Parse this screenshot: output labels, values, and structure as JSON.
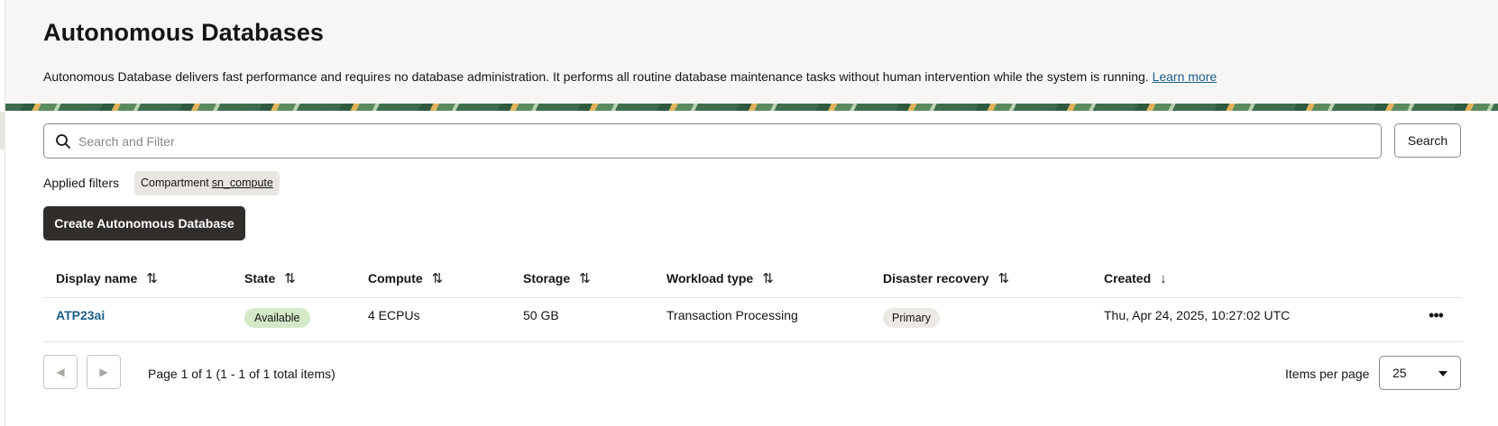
{
  "header": {
    "title": "Autonomous Databases",
    "description": "Autonomous Database delivers fast performance and requires no database administration. It performs all routine database maintenance tasks without human intervention while the system is running.",
    "learn_more": "Learn more"
  },
  "search": {
    "placeholder": "Search and Filter",
    "button_label": "Search",
    "icon": "search-icon"
  },
  "filters": {
    "label": "Applied filters",
    "chips": [
      {
        "name": "Compartment",
        "value": "sn_compute"
      }
    ]
  },
  "create_button": "Create Autonomous Database",
  "table": {
    "columns": [
      {
        "label": "Display name",
        "sort": "both"
      },
      {
        "label": "State",
        "sort": "both"
      },
      {
        "label": "Compute",
        "sort": "both"
      },
      {
        "label": "Storage",
        "sort": "both"
      },
      {
        "label": "Workload type",
        "sort": "both"
      },
      {
        "label": "Disaster recovery",
        "sort": "both"
      },
      {
        "label": "Created",
        "sort": "descending"
      }
    ],
    "rows": [
      {
        "display_name": "ATP23ai",
        "state": "Available",
        "compute": "4 ECPUs",
        "storage": "50 GB",
        "workload_type": "Transaction Processing",
        "disaster_recovery": "Primary",
        "created": "Thu, Apr 24, 2025, 10:27:02 UTC"
      }
    ]
  },
  "pagination": {
    "summary": "Page 1 of 1 (1 - 1 of 1 total items)",
    "items_per_page_label": "Items per page",
    "items_per_page": "25"
  },
  "colors": {
    "primary_button": "#312d2a",
    "link": "#1b5e8c",
    "available_badge": "#d3e9c8",
    "header_bg": "#f8f6f4"
  }
}
